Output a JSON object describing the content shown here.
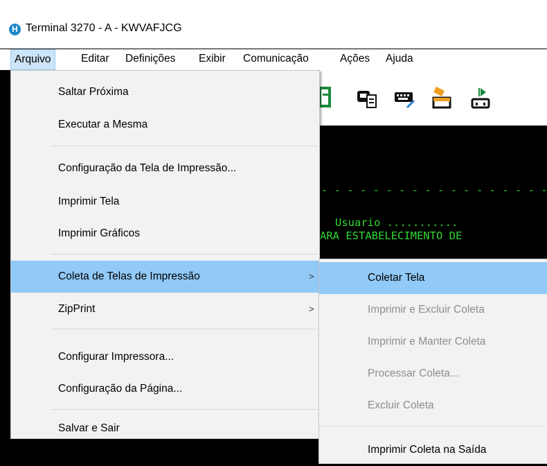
{
  "window": {
    "title": "Terminal 3270 - A - KWVAFJCG",
    "icon_letter": "H"
  },
  "menubar": {
    "items": [
      {
        "label": "Arquivo"
      },
      {
        "label": "Editar"
      },
      {
        "label": "Definições"
      },
      {
        "label": "Exibir"
      },
      {
        "label": "Comunicação"
      },
      {
        "label": "Ações"
      },
      {
        "label": "Ajuda"
      }
    ],
    "active": "Arquivo"
  },
  "terminal": {
    "dashes": "- - - - - - - - - - - - - - - - - - - -",
    "line1": "Usuario ...........",
    "line2": "ARA ESTABELECIMENTO DE"
  },
  "arquivo_menu": {
    "items": [
      {
        "label": "Saltar Próxima"
      },
      {
        "label": "Executar a Mesma"
      },
      {
        "label": "Configuração da Tela de Impressão..."
      },
      {
        "label": "Imprimir Tela"
      },
      {
        "label": "Imprimir Gráficos"
      },
      {
        "label": "Coleta de Telas de Impressão",
        "submenu_arrow": ">"
      },
      {
        "label": "ZipPrint",
        "submenu_arrow": ">"
      },
      {
        "label": "Configurar Impressora..."
      },
      {
        "label": "Configuração da Página..."
      },
      {
        "label": "Salvar e Sair"
      }
    ],
    "highlighted": "Coleta de Telas de Impressão"
  },
  "coleta_submenu": {
    "items": [
      {
        "label": "Coletar Tela",
        "enabled": true
      },
      {
        "label": "Imprimir e Excluir Coleta",
        "enabled": false
      },
      {
        "label": "Imprimir e Manter Coleta",
        "enabled": false
      },
      {
        "label": "Processar Coleta...",
        "enabled": false
      },
      {
        "label": "Excluir Coleta",
        "enabled": false
      },
      {
        "label": "Imprimir Coleta na Saída",
        "enabled": true
      }
    ],
    "highlighted": "Coletar Tela"
  },
  "colors": {
    "highlight": "#91c9f7",
    "menu_bg": "#f2f2f2",
    "terminal_text": "#33d633",
    "disabled_text": "#8d8d8d"
  }
}
